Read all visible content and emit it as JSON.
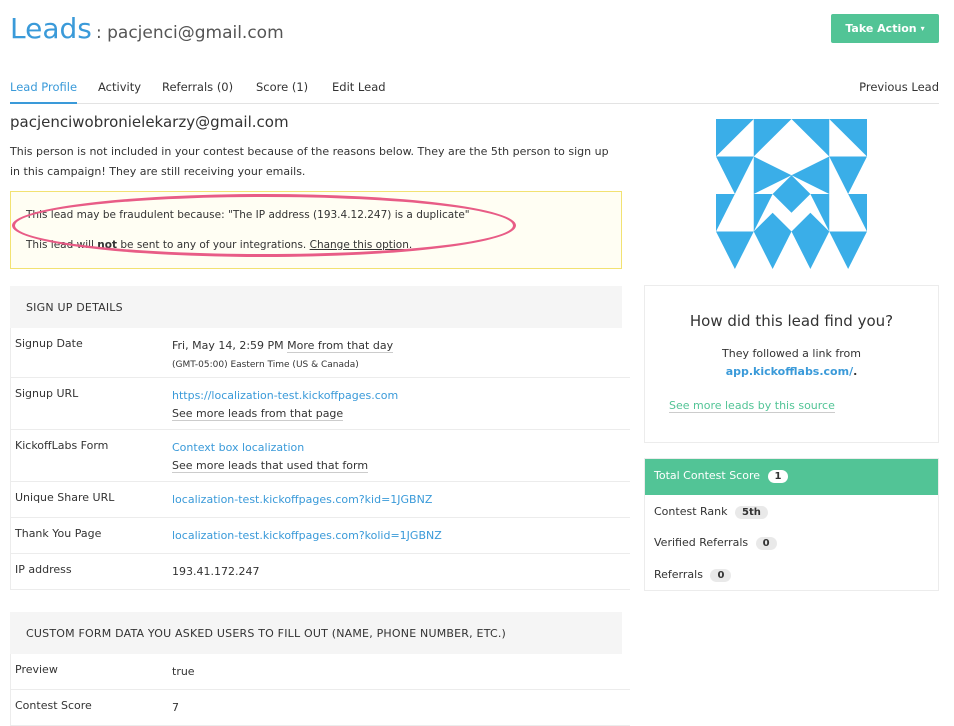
{
  "header": {
    "title": "Leads",
    "subtitle": ": pacjenci@gmail.com",
    "take_action": "Take Action",
    "take_action_caret": "▾"
  },
  "tabs": [
    {
      "label": "Lead Profile",
      "active": true
    },
    {
      "label": "Activity"
    },
    {
      "label": "Referrals (0)"
    },
    {
      "label": "Score (1)"
    },
    {
      "label": "Edit Lead"
    }
  ],
  "previous_lead": "Previous Lead",
  "lead": {
    "email": "pacjenciwobronielekarzy@gmail.com",
    "description": "This person is not included in your contest because of the reasons below. They are the 5th person to sign up in this campaign! They are still receiving your emails."
  },
  "alert": {
    "line1": "This lead may be fraudulent because: \"The IP address (193.4.12.247) is a duplicate\"",
    "line2_prefix": "This lead will ",
    "line2_bold": "not",
    "line2_suffix": " be sent to any of your integrations. ",
    "line2_link": "Change this option",
    "line2_end": "."
  },
  "signup_details": {
    "heading": "SIGN UP DETAILS",
    "rows": [
      {
        "key": "Signup Date",
        "value": "Fri, May 14, 2:59 PM",
        "link": "More from that day",
        "sub": "(GMT-05:00) Eastern Time (US & Canada)"
      },
      {
        "key": "Signup URL",
        "value": "https://localization-test.kickoffpages.com",
        "link": "See more leads from that page"
      },
      {
        "key": "KickoffLabs Form",
        "value": "Context box localization",
        "link": "See more leads that used that form"
      },
      {
        "key": "Unique Share URL",
        "value": "localization-test.kickoffpages.com?kid=1JGBNZ"
      },
      {
        "key": "Thank You Page",
        "value": "localization-test.kickoffpages.com?kolid=1JGBNZ"
      },
      {
        "key": "IP address",
        "value": "193.41.172.247"
      }
    ]
  },
  "custom_data": {
    "heading": "CUSTOM FORM DATA YOU ASKED USERS TO FILL OUT (NAME, PHONE NUMBER, ETC.)",
    "rows": [
      {
        "key": "Preview",
        "value": "true"
      },
      {
        "key": "Contest Score",
        "value": "7"
      }
    ]
  },
  "how_found": {
    "title": "How did this lead find you?",
    "text": "They followed a link from",
    "link": "app.kickofflabs.com/",
    "link_suffix": ".",
    "source_link": "See more leads by this source"
  },
  "score": {
    "heading": "Total Contest Score",
    "total": "1",
    "items": [
      {
        "label": "Contest Rank",
        "value": "5th"
      },
      {
        "label": "Verified Referrals",
        "value": "0"
      },
      {
        "label": "Referrals",
        "value": "0"
      }
    ]
  },
  "colors": {
    "accent_blue": "#3a9ad9",
    "accent_green": "#52c496",
    "highlight_pink": "#e85c86",
    "avatar_blue": "#3aaee8"
  }
}
